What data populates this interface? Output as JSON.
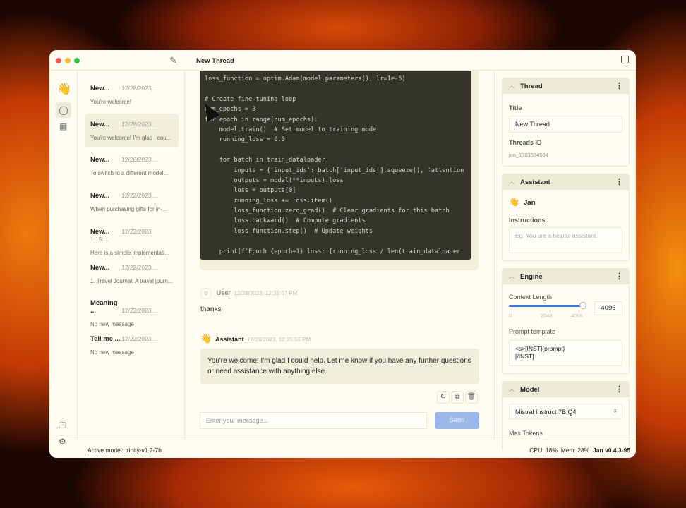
{
  "window": {
    "title": "New Thread"
  },
  "threads": [
    {
      "title": "New...",
      "date": "12/28/2023,...",
      "preview": "You're welcome!"
    },
    {
      "title": "New...",
      "date": "12/28/2023,...",
      "preview": "You're welcome! I'm glad I cou..."
    },
    {
      "title": "New...",
      "date": "12/26/2023,...",
      "preview": "To switch to a different model..."
    },
    {
      "title": "New...",
      "date": "12/22/2023,...",
      "preview": "When purchasing gifts for in-..."
    },
    {
      "title": "New...",
      "date": "12/22/2023, 1:15:...",
      "preview": "Here is a simple implementati..."
    },
    {
      "title": "New...",
      "date": "12/22/2023,...",
      "preview": "1. Travel Journal: A travel journ..."
    },
    {
      "title": "Meaning ...",
      "date": "12/22/2023,...",
      "preview": "No new message"
    },
    {
      "title": "Tell me ...",
      "date": "12/22/2023,...",
      "preview": "No new message"
    }
  ],
  "code_lines": [
    "loss_function = optim.Adam(model.parameters(), lr=1e-5)",
    "",
    "# Create fine-tuning loop",
    "num_epochs = 3",
    "for epoch in range(num_epochs):",
    "    model.train()  # Set model to training mode",
    "    running_loss = 0.0",
    "",
    "    for batch in train_dataloader:",
    "        inputs = {'input_ids': batch['input_ids'].squeeze(), 'attention",
    "        outputs = model(**inputs).loss",
    "        loss = outputs[0]",
    "        running_loss += loss.item()",
    "        loss_function.zero_grad()  # Clear gradients for this batch",
    "        loss.backward()  # Compute gradients",
    "        loss_function.step()  # Update weights",
    "",
    "    print(f'Epoch {epoch+1} loss: {running_loss / len(train_dataloader"
  ],
  "messages": [
    {
      "sender": "User",
      "time": "12/28/2023, 12:35:47 PM",
      "text": "thanks"
    },
    {
      "sender": "Assistant",
      "time": "12/28/2023, 12:35:56 PM",
      "text": "You're welcome! I'm glad I could help. Let me know if you have any further questions or need assistance with anything else."
    }
  ],
  "composer": {
    "placeholder": "Enter your message...",
    "send_label": "Send"
  },
  "right": {
    "thread": {
      "header": "Thread",
      "title_label": "Title",
      "title_value": "New Thread",
      "id_label": "Threads ID",
      "id_value": "jan_1703574534"
    },
    "assistant": {
      "header": "Assistant",
      "name": "Jan",
      "instructions_label": "Instructions",
      "instructions_placeholder": "Eg. You are a helpful assistant."
    },
    "engine": {
      "header": "Engine",
      "context_label": "Context Length",
      "context_value": "4096",
      "context_fraction": 1.0,
      "ticks": [
        "0",
        "2048",
        "4096"
      ],
      "prompt_label": "Prompt template",
      "prompt_value": "<s>[INST]{prompt}\n[/INST]"
    },
    "model": {
      "header": "Model",
      "selected": "Mistral Instruct 7B Q4",
      "max_tokens_label": "Max Tokens"
    }
  },
  "status": {
    "active_model": "Active model: trinity-v1.2-7b",
    "cpu": "CPU: 18%",
    "mem": "Mem: 28%",
    "version": "Jan v0.4.3-95"
  },
  "colors": {
    "accent": "#3b6fd8",
    "send": "#9bb8ea"
  }
}
